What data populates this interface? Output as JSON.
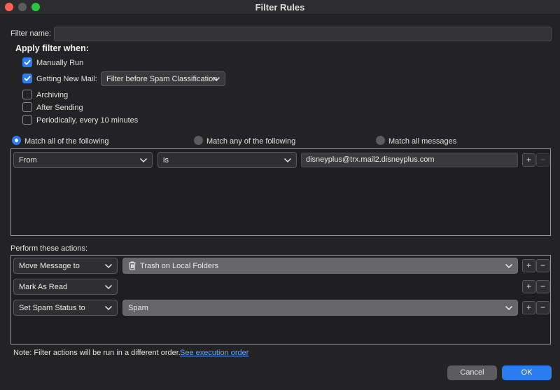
{
  "window": {
    "title": "Filter Rules"
  },
  "filter_name": {
    "label": "Filter name:",
    "value": ""
  },
  "apply_when": {
    "heading": "Apply filter when:",
    "manually_run": {
      "label": "Manually Run",
      "checked": true
    },
    "getting_new_mail": {
      "label": "Getting New Mail:",
      "checked": true,
      "option": "Filter before Spam Classification"
    },
    "archiving": {
      "label": "Archiving",
      "checked": false
    },
    "after_sending": {
      "label": "After Sending",
      "checked": false
    },
    "periodically": {
      "label": "Periodically, every 10 minutes",
      "checked": false
    }
  },
  "match": {
    "all": "Match all of the following",
    "any": "Match any of the following",
    "all_messages": "Match all messages",
    "selected": "all"
  },
  "conditions": [
    {
      "field": "From",
      "operator": "is",
      "value": "disneyplus@trx.mail2.disneyplus.com"
    }
  ],
  "actions": {
    "heading": "Perform these actions:",
    "rows": [
      {
        "action": "Move Message to",
        "target": "Trash on Local Folders",
        "target_icon": "trash-icon"
      },
      {
        "action": "Mark As Read",
        "target": ""
      },
      {
        "action": "Set Spam Status to",
        "target": "Spam"
      }
    ]
  },
  "note": {
    "text": "Note: Filter actions will be run in a different order.",
    "link": "See execution order"
  },
  "buttons": {
    "plus": "+",
    "minus": "−",
    "cancel": "Cancel",
    "ok": "OK"
  }
}
